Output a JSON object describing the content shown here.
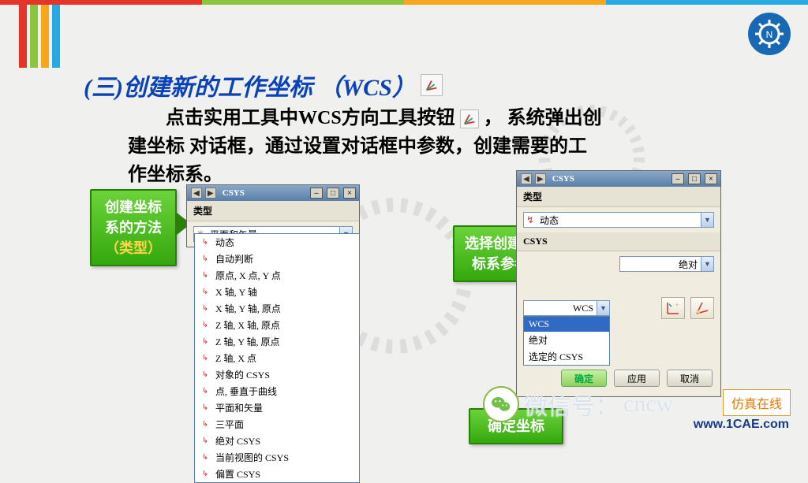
{
  "top_colors": [
    "#e5352b",
    "#8bc53f",
    "#f6a71c",
    "#27a9e1"
  ],
  "heading": {
    "prefix": "(三)",
    "text": "创建新的工作坐标",
    "paren_open": "（",
    "wcs": "WCS",
    "paren_close": "）"
  },
  "body": {
    "line1a": "点击实用工具中WCS方向工具按钮",
    "line1b": "，  系统弹出创",
    "line2": "建坐标 对话框，通过设置对话框中参数，创建需要的工",
    "line3": "作坐标系。"
  },
  "callouts": {
    "left": {
      "l1": "创建坐标",
      "l2": "系的方法",
      "l3": "（类型）"
    },
    "mid": {
      "l1": "选择创建坐",
      "l2": "标系参考"
    },
    "bottom": {
      "l1": "确定坐标"
    }
  },
  "dlg1": {
    "title": "CSYS",
    "section_type": "类型",
    "combo_value": "平面和矢量",
    "options": [
      "动态",
      "自动判断",
      "原点, X 点, Y 点",
      "X 轴, Y 轴",
      "X 轴, Y 轴, 原点",
      "Z 轴, X 轴, 原点",
      "Z 轴, Y 轴, 原点",
      "Z 轴, X 点",
      "对象的 CSYS",
      "点, 垂直于曲线",
      "平面和矢量",
      "三平面",
      "绝对 CSYS",
      "当前视图的 CSYS",
      "偏置 CSYS"
    ]
  },
  "dlg2": {
    "title": "CSYS",
    "section_type": "类型",
    "type_value": "动态",
    "section_ref": "CSYS",
    "ref_value": "绝对",
    "wcs_combo": "WCS",
    "wcs_options": [
      "WCS",
      "绝对",
      "选定的 CSYS"
    ],
    "buttons": {
      "ok": "确定",
      "apply": "应用",
      "cancel": "取消"
    }
  },
  "footer": {
    "wechat_label": "微信号：",
    "wechat_id": "cncw",
    "sim": "仿真在线",
    "url": "www.1CAE.com"
  }
}
